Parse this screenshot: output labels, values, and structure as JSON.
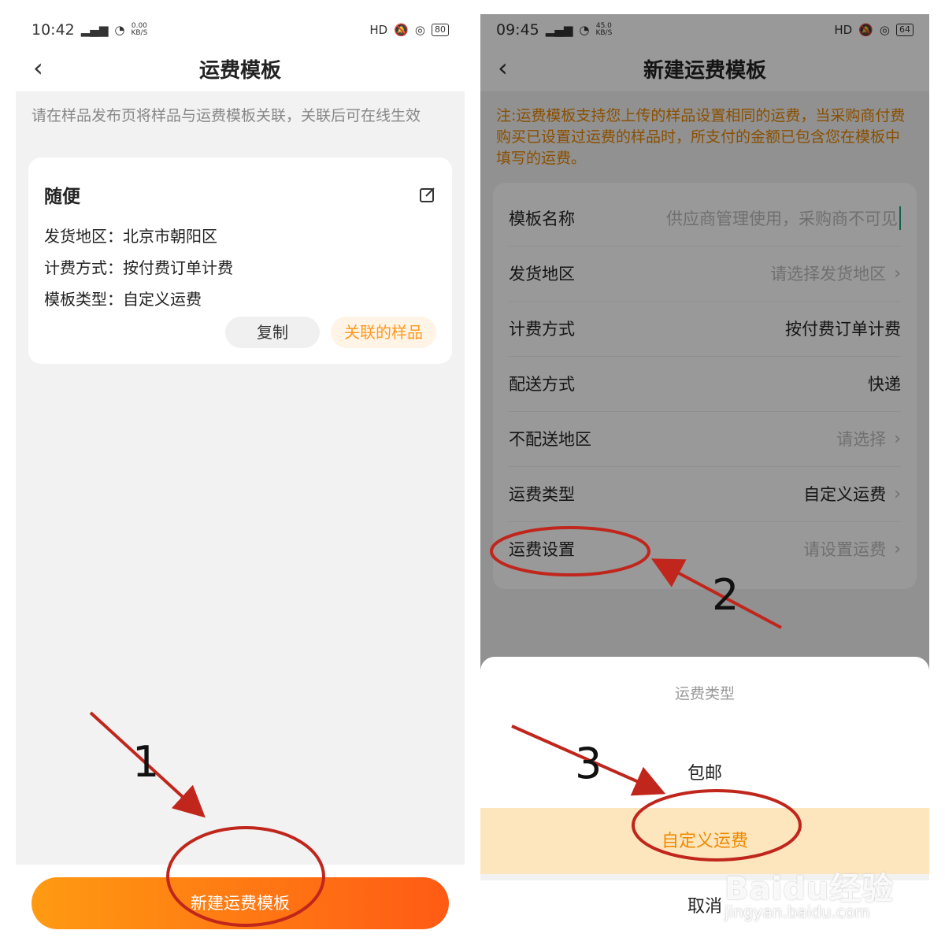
{
  "left": {
    "status": {
      "time": "10:42",
      "net_top": "0.00",
      "net_bottom": "KB/S",
      "battery": "80"
    },
    "title": "运费模板",
    "tip": "请在样品发布页将样品与运费模板关联，关联后可在线生效",
    "card": {
      "name": "随便",
      "lines": [
        {
          "label": "发货地区：",
          "value": "北京市朝阳区"
        },
        {
          "label": "计费方式：",
          "value": "按付费订单计费"
        },
        {
          "label": "模板类型：",
          "value": "自定义运费"
        }
      ],
      "copy_label": "复制",
      "linked_label": "关联的样品"
    },
    "new_button": "新建运费模板"
  },
  "right": {
    "status": {
      "time": "09:45",
      "net_top": "45.0",
      "net_bottom": "KB/S",
      "battery": "64"
    },
    "title": "新建运费模板",
    "tip": "注:运费模板支持您上传的样品设置相同的运费，当采购商付费购买已设置过运费的样品时，所支付的金额已包含您在模板中填写的运费。",
    "form": [
      {
        "label": "模板名称",
        "value": "供应商管理使用，采购商不可见"
      },
      {
        "label": "发货地区",
        "value": "请选择发货地区"
      },
      {
        "label": "计费方式",
        "value": "按付费订单计费"
      },
      {
        "label": "配送方式",
        "value": "快递"
      },
      {
        "label": "不配送地区",
        "value": "请选择"
      },
      {
        "label": "运费类型",
        "value": "自定义运费"
      },
      {
        "label": "运费设置",
        "value": "请设置运费"
      }
    ],
    "sheet": {
      "title": "运费类型",
      "options": [
        "包邮",
        "自定义运费"
      ],
      "selected": "自定义运费",
      "cancel": "取消"
    }
  },
  "annotations": {
    "step1": "1",
    "step2": "2",
    "step3": "3",
    "color": "#c0261c"
  },
  "watermark": {
    "logo": "Baidu经验",
    "url": "jingyan.baidu.com"
  },
  "colors": {
    "accent_orange": "#ff9a1f",
    "button_gradient_start": "#ff9a12",
    "button_gradient_end": "#ff5a14",
    "selected_bg": "#fde6bd"
  }
}
